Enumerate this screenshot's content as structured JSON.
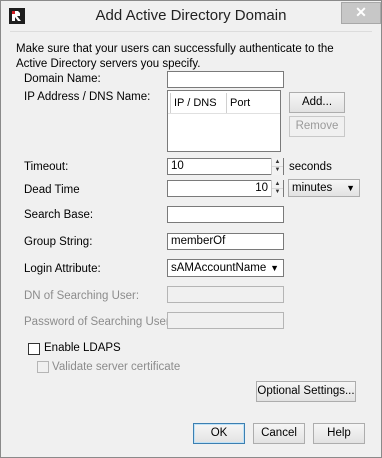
{
  "window": {
    "title": "Add Active Directory Domain"
  },
  "intro": "Make sure that your users can successfully authenticate to the Active Directory servers you specify.",
  "domain_name": {
    "label": "Domain Name:",
    "value": ""
  },
  "ip_dns": {
    "label": "IP Address / DNS Name:",
    "columns": [
      "IP / DNS",
      "Port"
    ],
    "add_label": "Add...",
    "remove_label": "Remove"
  },
  "timeout": {
    "label": "Timeout:",
    "value": "10",
    "unit": "seconds"
  },
  "dead_time": {
    "label": "Dead Time",
    "value": "10",
    "unit": "minutes"
  },
  "search_base": {
    "label": "Search Base:",
    "value": ""
  },
  "group_string": {
    "label": "Group String:",
    "value": "memberOf"
  },
  "login_attribute": {
    "label": "Login Attribute:",
    "value": "sAMAccountName"
  },
  "dn_searching_user": {
    "label": "DN of Searching User:",
    "value": ""
  },
  "password_searching_user": {
    "label": "Password of Searching User:",
    "value": ""
  },
  "enable_ldaps": {
    "label": "Enable LDAPS",
    "checked": false
  },
  "validate_cert": {
    "label": "Validate server certificate",
    "checked": false
  },
  "optional_settings_label": "Optional Settings...",
  "footer": {
    "ok": "OK",
    "cancel": "Cancel",
    "help": "Help"
  }
}
